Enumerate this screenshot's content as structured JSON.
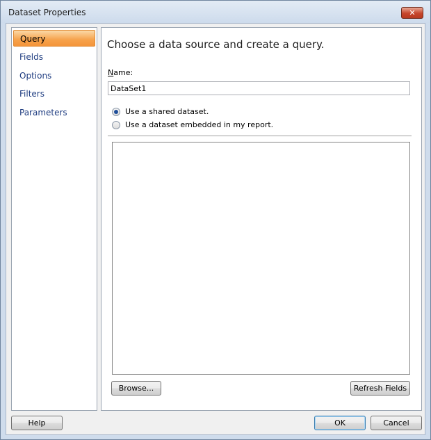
{
  "window": {
    "title": "Dataset Properties",
    "close_glyph": "✕"
  },
  "nav": {
    "items": [
      {
        "label": "Query",
        "selected": true
      },
      {
        "label": "Fields",
        "selected": false
      },
      {
        "label": "Options",
        "selected": false
      },
      {
        "label": "Filters",
        "selected": false
      },
      {
        "label": "Parameters",
        "selected": false
      }
    ]
  },
  "main": {
    "heading": "Choose a data source and create a query.",
    "name_label": "Name:",
    "name_value": "DataSet1",
    "radio_shared": "Use a shared dataset.",
    "radio_embedded": "Use a dataset embedded in my report.",
    "shared_selected": true,
    "browse_label": "Browse...",
    "refresh_label": "Refresh Fields"
  },
  "footer": {
    "help_label": "Help",
    "ok_label": "OK",
    "cancel_label": "Cancel"
  },
  "colors": {
    "selected_nav": "#f6a24b",
    "nav_text": "#1e3c80",
    "close_button": "#c6462c"
  }
}
